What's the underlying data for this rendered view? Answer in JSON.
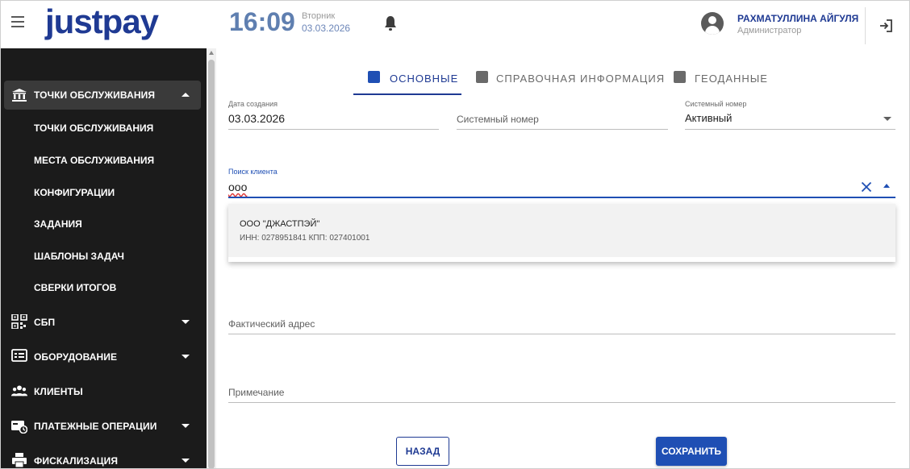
{
  "app": {
    "logo": "justpay",
    "time": "16:09",
    "weekday": "Вторник",
    "date": "03.03.2026"
  },
  "user": {
    "name": "РАХМАТУЛЛИНА АЙГУЛЯ",
    "role": "Администратор"
  },
  "sidebar": {
    "active_section": "ТОЧКИ ОБСЛУЖИВАНИЯ",
    "sub_items": [
      {
        "label": "ТОЧКИ ОБСЛУЖИВАНИЯ"
      },
      {
        "label": "МЕСТА ОБСЛУЖИВАНИЯ"
      },
      {
        "label": "КОНФИГУРАЦИИ"
      },
      {
        "label": "ЗАДАНИЯ"
      },
      {
        "label": "ШАБЛОНЫ ЗАДАЧ"
      },
      {
        "label": "СВЕРКИ ИТОГОВ"
      }
    ],
    "sections": [
      {
        "label": "СБП",
        "icon": "qr-code-icon"
      },
      {
        "label": "ОБОРУДОВАНИЕ",
        "icon": "terminal-icon"
      },
      {
        "label": "КЛИЕНТЫ",
        "icon": "people-icon"
      },
      {
        "label": "ПЛАТЕЖНЫЕ ОПЕРАЦИИ",
        "icon": "payment-icon"
      },
      {
        "label": "ФИСКАЛИЗАЦИЯ",
        "icon": "printer-icon"
      }
    ]
  },
  "tabs": [
    {
      "label": "ОСНОВНЫЕ",
      "active": true
    },
    {
      "label": "СПРАВОЧНАЯ ИНФОРМАЦИЯ",
      "active": false
    },
    {
      "label": "ГЕОДАННЫЕ",
      "active": false
    }
  ],
  "form": {
    "created_label": "Дата создания",
    "created_value": "03.03.2026",
    "system_number_placeholder": "Системный номер",
    "status_label": "Системный номер",
    "status_value": "Активный",
    "client_search_label": "Поиск клиента",
    "client_search_value": "ооо",
    "actual_address_placeholder": "Фактический адрес",
    "note_placeholder": "Примечание"
  },
  "dropdown": {
    "options": [
      {
        "title": "ООО \"ДЖАСТПЭЙ\"",
        "subtitle": "ИНН: 0278951841 КПП: 027401001"
      }
    ]
  },
  "buttons": {
    "back": "НАЗАД",
    "save": "СОХРАНИТЬ"
  },
  "colors": {
    "brand": "#1f3a93",
    "sidebar_bg": "#1b1b1b",
    "primary_button": "#1f4fb4"
  }
}
